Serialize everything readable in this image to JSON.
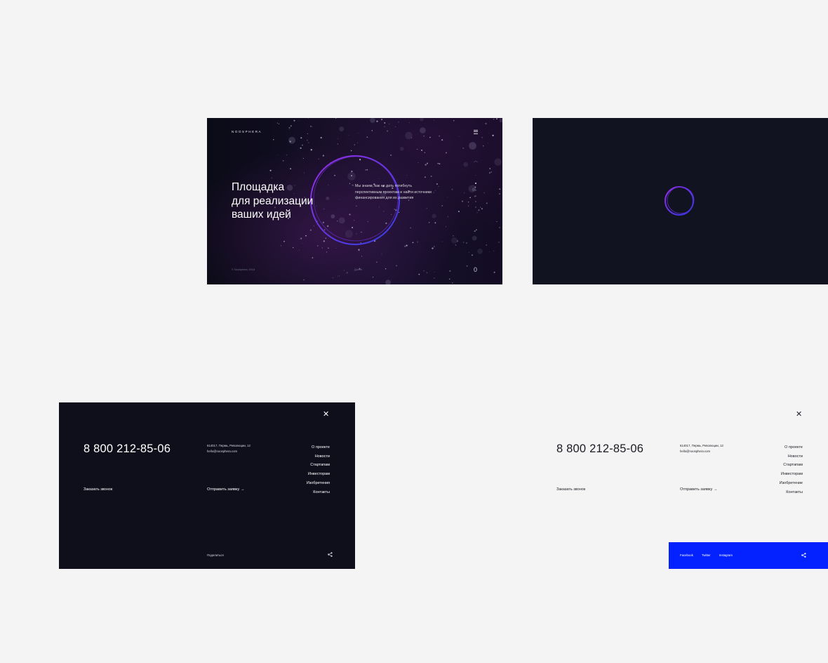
{
  "hero": {
    "logo": "NOOSPHERA",
    "headline": [
      "Площадка",
      "для реализации",
      "ваших идей"
    ],
    "description": "Мы знаем, как не дать погибнуть перспективным проектам и найти источники финансирования для их развития",
    "copyright": "© Noosphera, 2018",
    "scroll_hint": "Далее",
    "slide_counter": "0",
    "menu_icon": "burger-menu-icon",
    "accent_colors": [
      "#7a2bd6",
      "#3b3be8"
    ]
  },
  "loader": {
    "spinner_icon": "loading-ring-icon"
  },
  "menu": {
    "phone": "8 800 212-85-06",
    "address_line1": "614017, Пермь, Революции, 12",
    "email": "hello@noosphera.com",
    "callback_label": "Заказать звонок",
    "send_label": "Отправить заявку",
    "share_label": "Поделиться",
    "nav_dark": [
      "О проекте",
      "Новости",
      "Стартапам",
      "Инвесторам",
      "Изобретения",
      "Контакты"
    ],
    "nav_light": [
      "О проекте",
      "Новости",
      "Стартапам",
      "Инвесторам",
      "Изобретение",
      "Контакты"
    ],
    "social": [
      "Facebook",
      "Twitter",
      "Instagram"
    ],
    "social_bg": "#0322ff",
    "dark_bg": "#0e0f1b"
  }
}
